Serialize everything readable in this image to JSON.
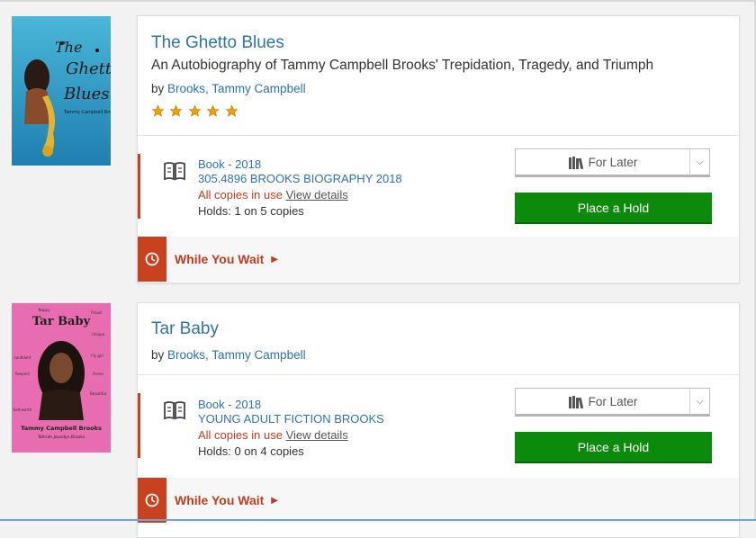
{
  "records": [
    {
      "title": "The Ghetto Blues",
      "subtitle": "An Autobiography of Tammy Campbell Brooks' Trepidation, Tragedy, and Triumph",
      "by_label": "by",
      "author": "Brooks, Tammy Campbell",
      "rating_stars": 5,
      "format": "Book - 2018",
      "call_number": "305.4896 BROOKS BIOGRAPHY 2018",
      "status": "All copies in use",
      "details_link": "View details",
      "holds": "Holds: 1 on 5 copies",
      "for_later": "For Later",
      "place_hold": "Place a Hold",
      "while_you_wait": "While You Wait"
    },
    {
      "title": "Tar Baby",
      "by_label": "by",
      "author": "Brooks, Tammy Campbell",
      "format": "Book - 2018",
      "call_number": "YOUNG ADULT FICTION BROOKS",
      "status": "All copies in use",
      "details_link": "View details",
      "holds": "Holds: 0 on 4 copies",
      "for_later": "For Later",
      "place_hold": "Place a Hold",
      "while_you_wait": "While You Wait",
      "cover_text": {
        "title": "Tar Baby",
        "author": "Tammy Campbell Brooks",
        "illustrator": "Tahirah Jovadyn Brooks",
        "words": [
          "Nappy",
          "Proud",
          "Unique",
          "Fly girl",
          "Fierce",
          "Beautiful",
          "Self-worth",
          "Respect",
          "confident"
        ]
      }
    }
  ],
  "colors": {
    "link": "#2f73a8",
    "alert": "#c23b20",
    "hold_button": "#0b8a0b",
    "star": "#f0a000"
  }
}
